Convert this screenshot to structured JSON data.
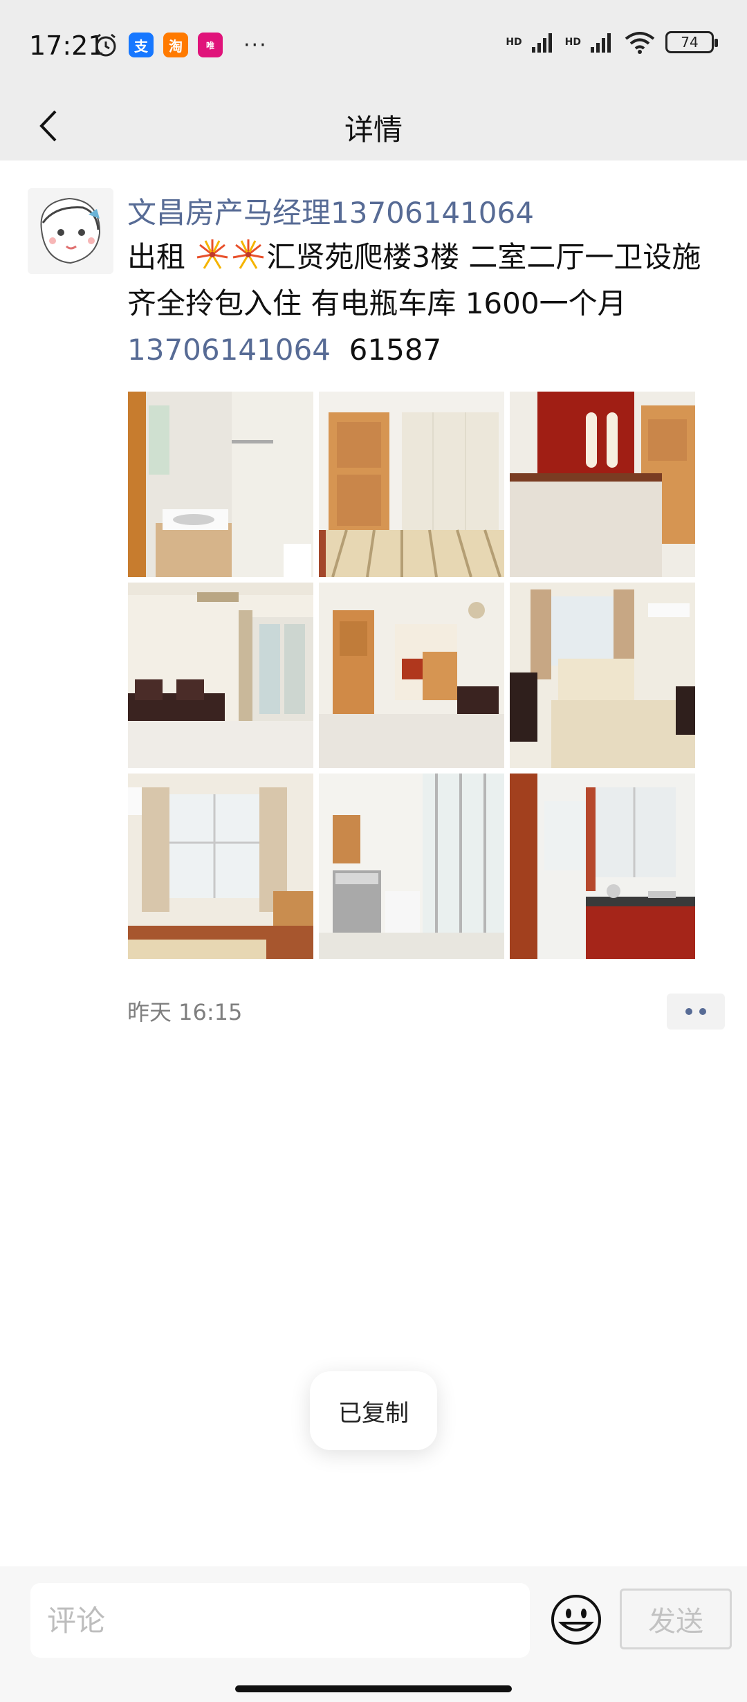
{
  "status": {
    "time": "17:21",
    "signal1": "HD",
    "signal2": "HD",
    "battery": "74",
    "more": "···"
  },
  "nav": {
    "title": "详情"
  },
  "post": {
    "author": "文昌房产马经理13706141064",
    "text_prefix": "出租 ",
    "text_main": "汇贤苑爬楼3楼  二室二厅一卫设施齐全拎包入住 有电瓶车库 1600一个月",
    "phone": "13706141064",
    "text_suffix": "  61587",
    "time": "昨天 16:15",
    "photos": [
      "bathroom-photo",
      "bedroom-photo",
      "bedroom-red-wardrobe-photo",
      "living-room-photo",
      "hallway-dining-photo",
      "bedroom-sofa-photo",
      "bedroom-window-photo",
      "balcony-washer-photo",
      "kitchen-photo"
    ]
  },
  "toast": {
    "text": "已复制"
  },
  "comment": {
    "placeholder": "评论",
    "send_label": "发送"
  },
  "colors": {
    "link": "#576b95",
    "bar_bg": "#ededed"
  }
}
